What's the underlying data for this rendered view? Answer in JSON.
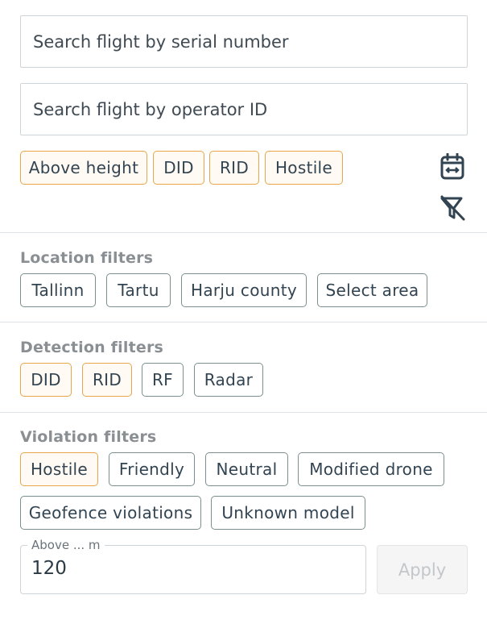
{
  "search": {
    "serial_placeholder": "Search flight by serial number",
    "operator_placeholder": "Search flight by operator ID"
  },
  "quick_filters": [
    {
      "label": "Above height",
      "active": true
    },
    {
      "label": "DID",
      "active": true
    },
    {
      "label": "RID",
      "active": true
    },
    {
      "label": "Hostile",
      "active": true
    }
  ],
  "icons": {
    "date_range": "calendar-range-icon",
    "clear_filters": "filter-off-icon"
  },
  "location": {
    "title": "Location filters",
    "chips": [
      {
        "label": "Tallinn",
        "active": false
      },
      {
        "label": "Tartu",
        "active": false
      },
      {
        "label": "Harju county",
        "active": false
      },
      {
        "label": "Select area",
        "active": false
      }
    ]
  },
  "detection": {
    "title": "Detection filters",
    "chips": [
      {
        "label": "DID",
        "active": true
      },
      {
        "label": "RID",
        "active": true
      },
      {
        "label": "RF",
        "active": false
      },
      {
        "label": "Radar",
        "active": false
      }
    ]
  },
  "violation": {
    "title": "Violation filters",
    "chips": [
      {
        "label": "Hostile",
        "active": true
      },
      {
        "label": "Friendly",
        "active": false
      },
      {
        "label": "Neutral",
        "active": false
      },
      {
        "label": "Modified drone",
        "active": false
      },
      {
        "label": "Geofence violations",
        "active": false
      },
      {
        "label": "Unknown model",
        "active": false
      }
    ]
  },
  "height_field": {
    "label": "Above ... m",
    "value": "120"
  },
  "apply_button": {
    "label": "Apply",
    "enabled": false
  },
  "colors": {
    "active_border": "#e8a54a",
    "inactive_border": "#7b8f8f",
    "section_title": "#8a8f94"
  }
}
